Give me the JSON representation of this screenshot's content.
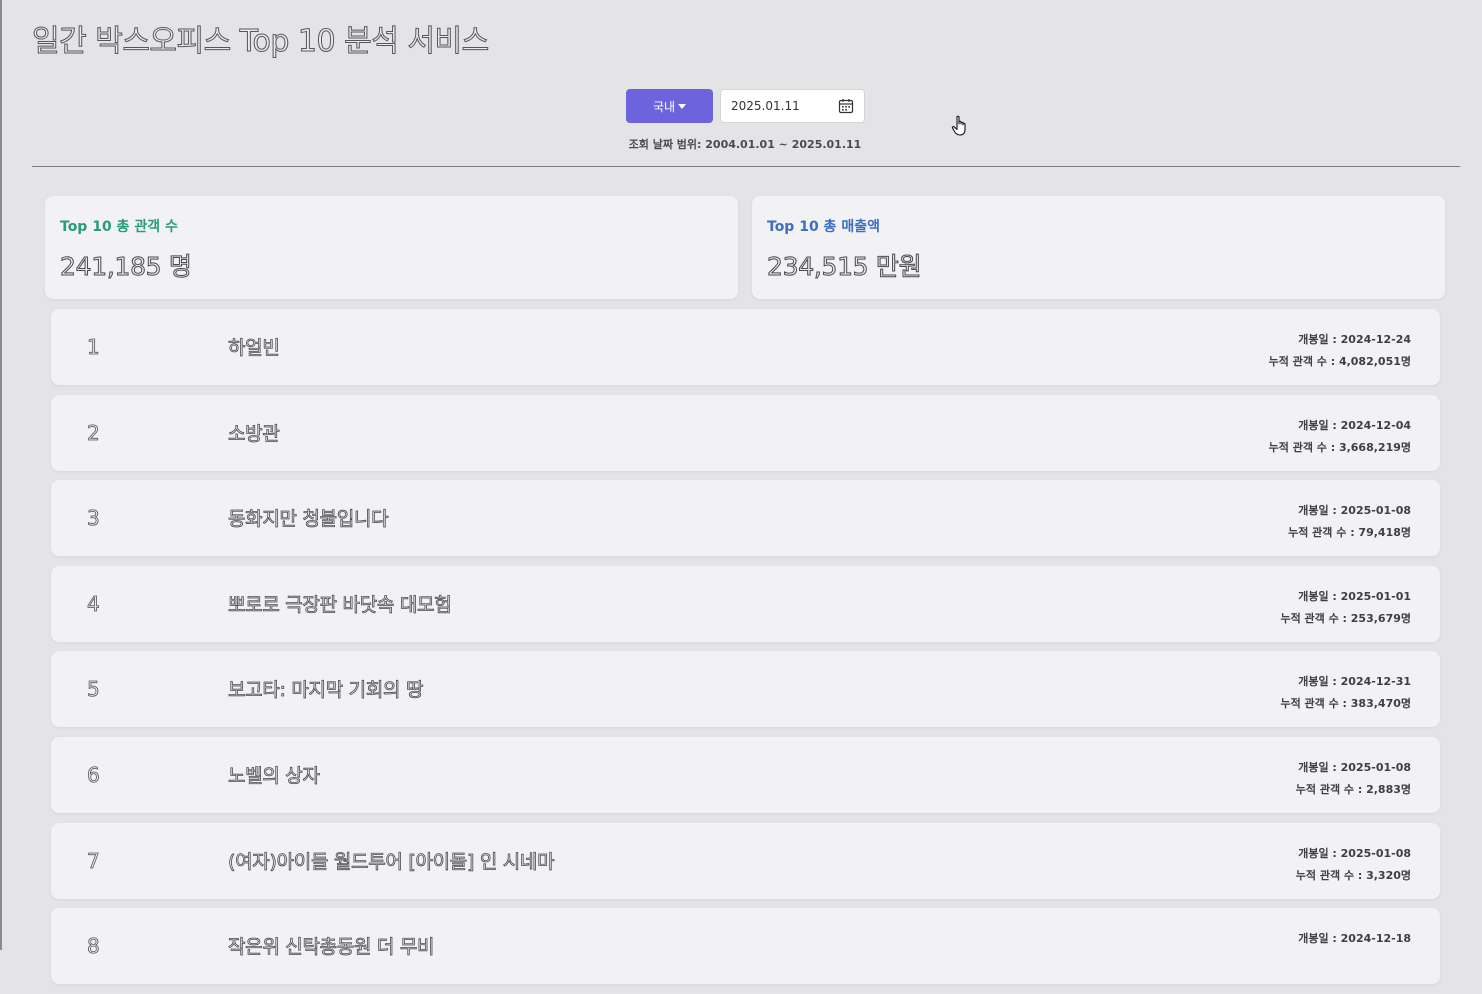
{
  "header": {
    "title": "일간 박스오피스 Top 10 분석 서비스"
  },
  "controls": {
    "region_label": "국내",
    "date_value": "2025.01.11",
    "date_range": "조회 날짜 범위: 2004.01.01 ~ 2025.01.11"
  },
  "stats": {
    "audience": {
      "label": "Top 10 총 관객 수",
      "value": "241,185 명"
    },
    "sales": {
      "label": "Top 10 총 매출액",
      "value": "234,515 만원"
    }
  },
  "movies": [
    {
      "rank": "1",
      "title": "하얼빈",
      "release": "개봉일 : 2024-12-24",
      "cumulative": "누적 관객 수 : 4,082,051명"
    },
    {
      "rank": "2",
      "title": "소방관",
      "release": "개봉일 : 2024-12-04",
      "cumulative": "누적 관객 수 : 3,668,219명"
    },
    {
      "rank": "3",
      "title": "동화지만 청불입니다",
      "release": "개봉일 : 2025-01-08",
      "cumulative": "누적 관객 수 : 79,418명"
    },
    {
      "rank": "4",
      "title": "뽀로로 극장판 바닷속 대모험",
      "release": "개봉일 : 2025-01-01",
      "cumulative": "누적 관객 수 : 253,679명"
    },
    {
      "rank": "5",
      "title": "보고타: 마지막 기회의 땅",
      "release": "개봉일 : 2024-12-31",
      "cumulative": "누적 관객 수 : 383,470명"
    },
    {
      "rank": "6",
      "title": "노벨의 상자",
      "release": "개봉일 : 2025-01-08",
      "cumulative": "누적 관객 수 : 2,883명"
    },
    {
      "rank": "7",
      "title": "(여자)아이들 월드투어 [아이돌] 인 시네마",
      "release": "개봉일 : 2025-01-08",
      "cumulative": "누적 관객 수 : 3,320명"
    },
    {
      "rank": "8",
      "title": "작은위 신탁총동원 더 무비",
      "release": "개봉일 : 2024-12-18",
      "cumulative": ""
    }
  ],
  "colors": {
    "accent": "#6c63dd",
    "audience_label": "#279b7b",
    "sales_label": "#3f6ec0"
  },
  "icons": [
    "calendar-icon",
    "hand-pointer-icon",
    "caret-down-icon"
  ]
}
